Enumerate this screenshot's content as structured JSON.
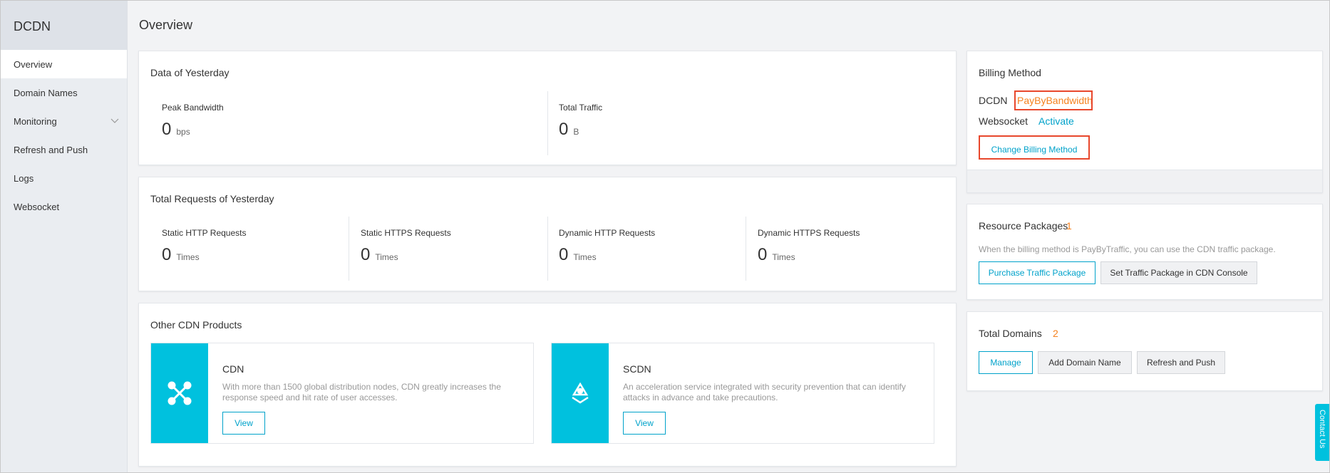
{
  "sidebar": {
    "title": "DCDN",
    "items": [
      {
        "label": "Overview",
        "active": true
      },
      {
        "label": "Domain Names"
      },
      {
        "label": "Monitoring",
        "expandable": true
      },
      {
        "label": "Refresh and Push"
      },
      {
        "label": "Logs"
      },
      {
        "label": "Websocket"
      }
    ]
  },
  "page": {
    "title": "Overview"
  },
  "yesterday": {
    "title": "Data of Yesterday",
    "peak_label": "Peak Bandwidth",
    "peak_value": "0",
    "peak_unit": "bps",
    "traffic_label": "Total Traffic",
    "traffic_value": "0",
    "traffic_unit": "B"
  },
  "requests": {
    "title": "Total Requests of Yesterday",
    "items": [
      {
        "label": "Static HTTP Requests",
        "value": "0",
        "unit": "Times"
      },
      {
        "label": "Static HTTPS Requests",
        "value": "0",
        "unit": "Times"
      },
      {
        "label": "Dynamic HTTP Requests",
        "value": "0",
        "unit": "Times"
      },
      {
        "label": "Dynamic HTTPS Requests",
        "value": "0",
        "unit": "Times"
      }
    ]
  },
  "products": {
    "title": "Other CDN Products",
    "items": [
      {
        "name": "CDN",
        "desc": "With more than 1500 global distribution nodes, CDN greatly increases the response speed and hit rate of user accesses.",
        "button": "View"
      },
      {
        "name": "SCDN",
        "desc": "An acceleration service integrated with security prevention that can identify attacks in advance and take precautions.",
        "button": "View"
      }
    ]
  },
  "billing": {
    "title": "Billing Method",
    "dcdn_label": "DCDN",
    "dcdn_value": "PayByBandwidth",
    "ws_label": "Websocket",
    "ws_action": "Activate",
    "change_button": "Change Billing Method"
  },
  "resources": {
    "title": "Resource Packages",
    "count": "1",
    "note": "When the billing method is PayByTraffic, you can use the CDN traffic package.",
    "purchase_button": "Purchase Traffic Package",
    "console_button": "Set Traffic Package in CDN Console"
  },
  "domains": {
    "title": "Total Domains",
    "count": "2",
    "manage_button": "Manage",
    "add_button": "Add Domain Name",
    "refresh_button": "Refresh and Push"
  },
  "contact": {
    "label": "Contact Us"
  },
  "colors": {
    "accent": "#00c1de",
    "link": "#00a2ca",
    "highlight": "#f5821f",
    "annotation": "#e8472c"
  }
}
